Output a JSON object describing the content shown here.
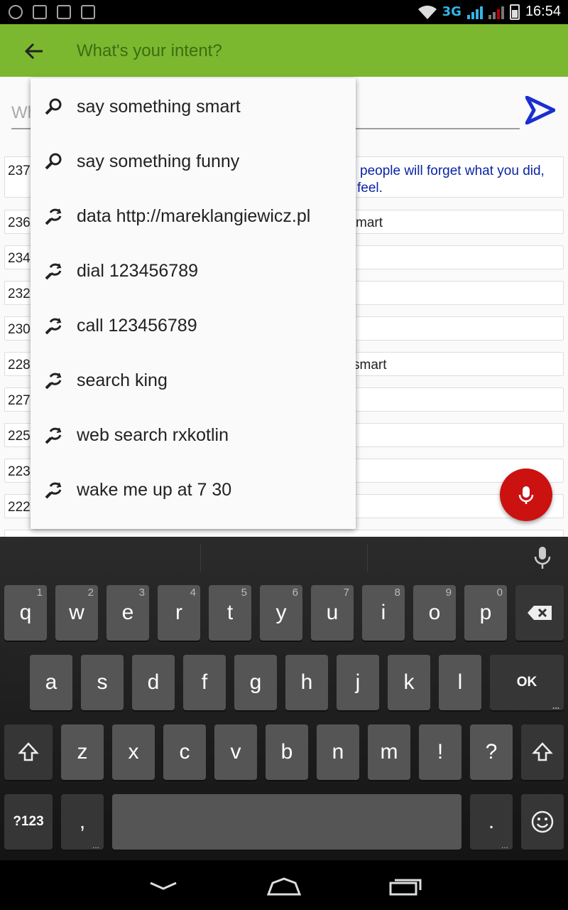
{
  "status": {
    "network": "3G",
    "time": "16:54"
  },
  "toolbar": {
    "title": "What's your intent?"
  },
  "input": {
    "partial_text": "Wh"
  },
  "history": [
    {
      "id": "237",
      "text": "people will forget what you did,",
      "text2": "feel.",
      "accent": true
    },
    {
      "id": "236",
      "text": "mart"
    },
    {
      "id": "234",
      "text": ""
    },
    {
      "id": "232",
      "text": ""
    },
    {
      "id": "230",
      "text": ""
    },
    {
      "id": "228",
      "text": "smart"
    },
    {
      "id": "227",
      "text": ""
    },
    {
      "id": "225",
      "text": ""
    },
    {
      "id": "223",
      "text": ""
    },
    {
      "id": "222",
      "text": ""
    }
  ],
  "suggestions": [
    {
      "label": "say something smart",
      "icon": "search-icon"
    },
    {
      "label": "say something funny",
      "icon": "search-icon"
    },
    {
      "label": "data http://mareklangiewicz.pl",
      "icon": "history-search-icon"
    },
    {
      "label": "dial 123456789",
      "icon": "history-search-icon"
    },
    {
      "label": "call 123456789",
      "icon": "history-search-icon"
    },
    {
      "label": "search king",
      "icon": "history-search-icon"
    },
    {
      "label": "web search rxkotlin",
      "icon": "history-search-icon"
    },
    {
      "label": "wake me up at 7 30",
      "icon": "history-search-icon"
    }
  ],
  "keyboard": {
    "row1": [
      {
        "k": "q",
        "h": "1"
      },
      {
        "k": "w",
        "h": "2"
      },
      {
        "k": "e",
        "h": "3"
      },
      {
        "k": "r",
        "h": "4"
      },
      {
        "k": "t",
        "h": "5"
      },
      {
        "k": "y",
        "h": "6"
      },
      {
        "k": "u",
        "h": "7"
      },
      {
        "k": "i",
        "h": "8"
      },
      {
        "k": "o",
        "h": "9"
      },
      {
        "k": "p",
        "h": "0"
      }
    ],
    "row2": [
      "a",
      "s",
      "d",
      "f",
      "g",
      "h",
      "j",
      "k",
      "l"
    ],
    "row3": [
      "z",
      "x",
      "c",
      "v",
      "b",
      "n",
      "m",
      "!",
      "?"
    ],
    "ok_label": "OK",
    "symbols_label": "?123",
    "comma_label": ",",
    "period_label": ".",
    "backspace_icon": "backspace-icon",
    "shift_icon": "shift-icon",
    "emoji_icon": "emoji-icon"
  },
  "colors": {
    "toolbar": "#7cb82f",
    "fab": "#cc1111",
    "send": "#1a2fd0",
    "accent_text": "#0b24a4"
  }
}
